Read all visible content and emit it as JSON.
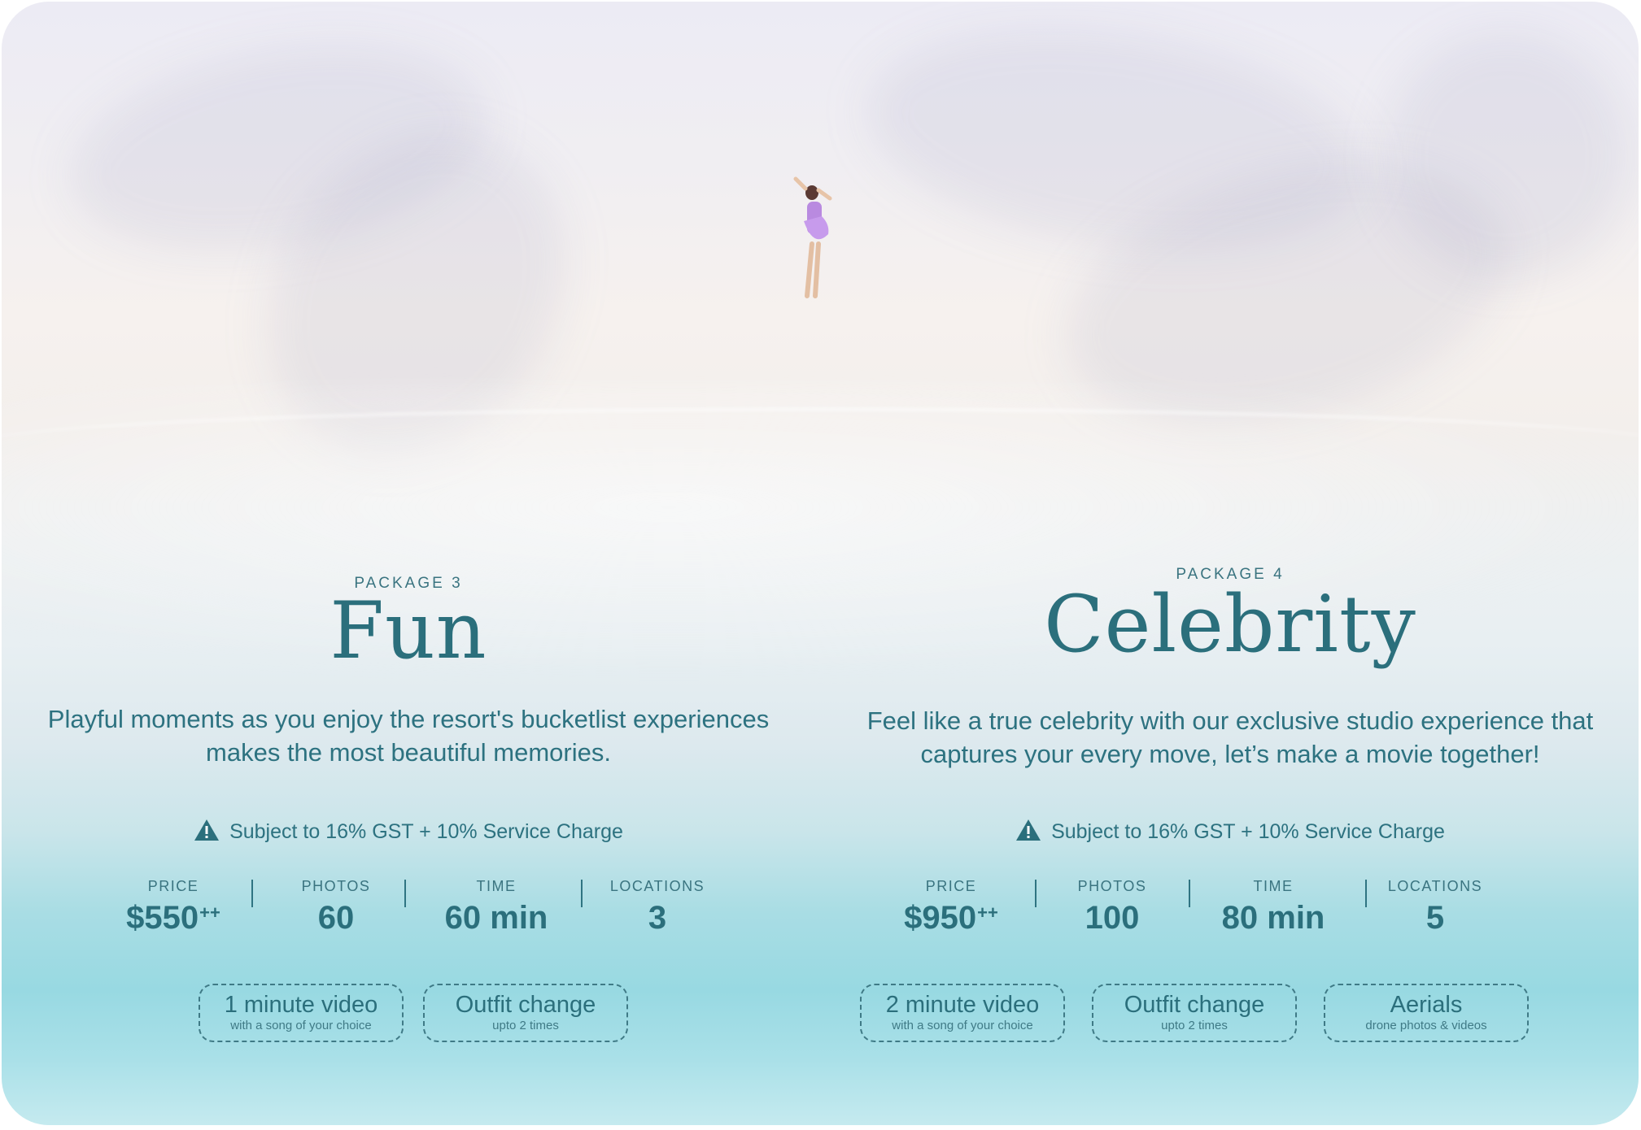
{
  "packages": [
    {
      "label": "PACKAGE 3",
      "title": "Fun",
      "description": "Playful moments as you enjoy the resort's bucketlist experiences makes the most beautiful memories.",
      "notice": "Subject to 16% GST + 10% Service Charge",
      "stats": [
        {
          "label": "PRICE",
          "value": "$550",
          "suffix": "++"
        },
        {
          "label": "PHOTOS",
          "value": "60"
        },
        {
          "label": "TIME",
          "value": "60 min"
        },
        {
          "label": "LOCATIONS",
          "value": "3"
        }
      ],
      "extras": [
        {
          "title": "1 minute video",
          "subtitle": "with a song of your choice"
        },
        {
          "title": "Outfit change",
          "subtitle": "upto 2 times"
        }
      ]
    },
    {
      "label": "PACKAGE 4",
      "title": "Celebrity",
      "description": "Feel like a true celebrity with our exclusive studio experience that captures your every move, let’s make a movie together!",
      "notice": "Subject to 16% GST + 10% Service Charge",
      "stats": [
        {
          "label": "PRICE",
          "value": "$950",
          "suffix": "++"
        },
        {
          "label": "PHOTOS",
          "value": "100"
        },
        {
          "label": "TIME",
          "value": "80 min"
        },
        {
          "label": "LOCATIONS",
          "value": "5"
        }
      ],
      "extras": [
        {
          "title": "2 minute video",
          "subtitle": "with a song of your choice"
        },
        {
          "title": "Outfit change",
          "subtitle": "upto 2 times"
        },
        {
          "title": "Aerials",
          "subtitle": "drone photos & videos"
        }
      ]
    }
  ],
  "icons": {
    "warning": "warning-triangle-icon"
  },
  "colors": {
    "text": "#2b6f7c",
    "chip_border": "#3f7a86"
  }
}
